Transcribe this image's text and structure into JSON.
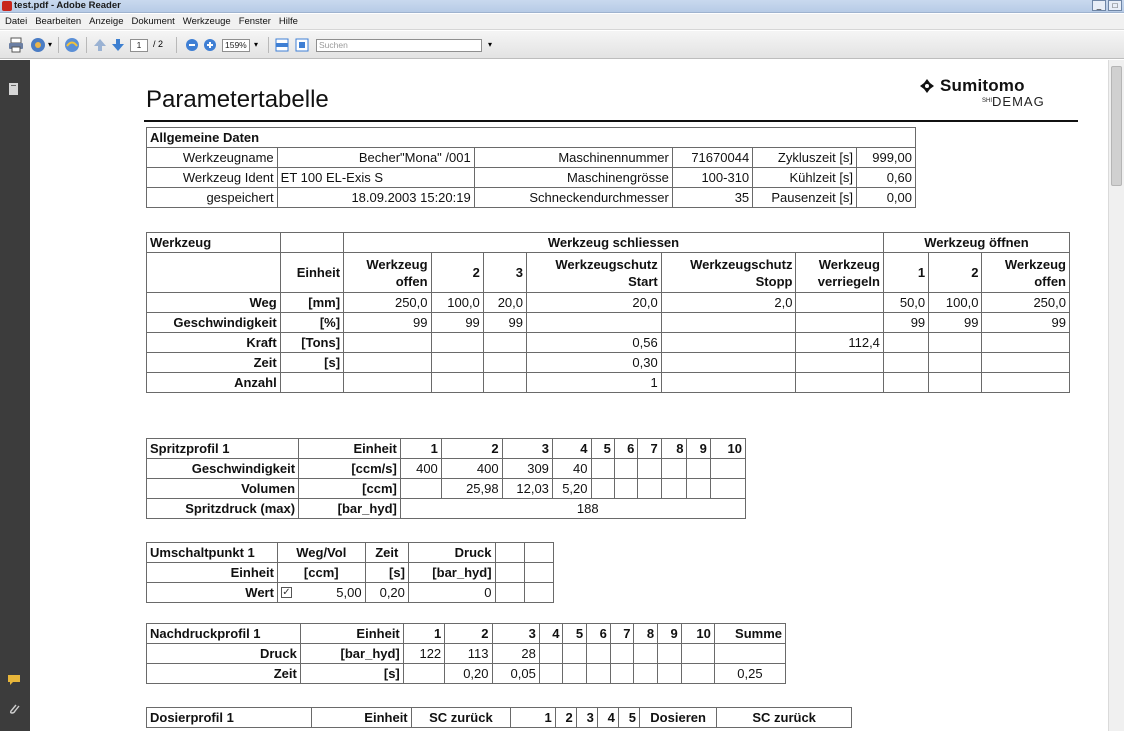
{
  "window": {
    "title": "test.pdf - Adobe Reader",
    "controls": [
      "_",
      "□",
      "×"
    ]
  },
  "menu": [
    "Datei",
    "Bearbeiten",
    "Anzeige",
    "Dokument",
    "Werkzeuge",
    "Fenster",
    "Hilfe"
  ],
  "toolbar": {
    "page_current": "1",
    "page_total": "/ 2",
    "zoom": "159%",
    "search_placeholder": "Suchen"
  },
  "page": {
    "title": "Parametertabelle",
    "logo_brand": "Sumitomo",
    "logo_sub": "DEMAG",
    "logo_prefix": "SHI"
  },
  "allgemein": {
    "header": "Allgemeine Daten",
    "rows": [
      [
        "Werkzeugname",
        "Becher\"Mona\"  /001",
        "Maschinennummer",
        "71670044",
        "Zykluszeit [s]",
        "999,00"
      ],
      [
        "Werkzeug Ident",
        "ET 100 EL-Exis S",
        "Maschinengrösse",
        "100-310",
        "Kühlzeit [s]",
        "0,60"
      ],
      [
        "gespeichert",
        "18.09.2003 15:20:19",
        "Schneckendurchmesser",
        "35",
        "Pausenzeit [s]",
        "0,00"
      ]
    ]
  },
  "werkzeug": {
    "title": "Werkzeug",
    "group_close": "Werkzeug schliessen",
    "group_open": "Werkzeug öffnen",
    "einheit": "Einheit",
    "cols": [
      "Werkzeug offen",
      "2",
      "3",
      "Werkzeugschutz Start",
      "Werkzeugschutz Stopp",
      "Werkzeug verriegeln",
      "1",
      "2",
      "Werkzeug offen"
    ],
    "rows": [
      {
        "label": "Weg",
        "unit": "[mm]",
        "v": [
          "250,0",
          "100,0",
          "20,0",
          "20,0",
          "2,0",
          "",
          "50,0",
          "100,0",
          "250,0"
        ]
      },
      {
        "label": "Geschwindigkeit",
        "unit": "[%]",
        "v": [
          "99",
          "99",
          "99",
          "",
          "",
          "",
          "99",
          "99",
          "99"
        ]
      },
      {
        "label": "Kraft",
        "unit": "[Tons]",
        "v": [
          "",
          "",
          "",
          "0,56",
          "",
          "112,4",
          "",
          "",
          ""
        ]
      },
      {
        "label": "Zeit",
        "unit": "[s]",
        "v": [
          "",
          "",
          "",
          "0,30",
          "",
          "",
          "",
          "",
          ""
        ]
      },
      {
        "label": "Anzahl",
        "unit": "",
        "v": [
          "",
          "",
          "",
          "1",
          "",
          "",
          "",
          "",
          ""
        ]
      }
    ]
  },
  "spritz": {
    "title": "Spritzprofil 1",
    "einheit": "Einheit",
    "cols": [
      "1",
      "2",
      "3",
      "4",
      "5",
      "6",
      "7",
      "8",
      "9",
      "10"
    ],
    "rows": [
      {
        "label": "Geschwindigkeit",
        "unit": "[ccm/s]",
        "v": [
          "400",
          "400",
          "309",
          "40",
          "",
          "",
          "",
          "",
          "",
          ""
        ]
      },
      {
        "label": "Volumen",
        "unit": "[ccm]",
        "v": [
          "",
          "25,98",
          "12,03",
          "5,20",
          "",
          "",
          "",
          "",
          "",
          ""
        ]
      }
    ],
    "druck_label": "Spritzdruck (max)",
    "druck_unit": "[bar_hyd]",
    "druck_value": "188"
  },
  "umschalt": {
    "title": "Umschaltpunkt 1",
    "cols": [
      "Weg/Vol",
      "Zeit",
      "Druck"
    ],
    "einheit_label": "Einheit",
    "units": [
      "[ccm]",
      "[s]",
      "[bar_hyd]"
    ],
    "wert_label": "Wert",
    "checkbox": "✓",
    "values": [
      "5,00",
      "0,20",
      "0"
    ]
  },
  "nachdruck": {
    "title": "Nachdruckprofil 1",
    "einheit": "Einheit",
    "cols": [
      "1",
      "2",
      "3",
      "4",
      "5",
      "6",
      "7",
      "8",
      "9",
      "10"
    ],
    "summe": "Summe",
    "rows": [
      {
        "label": "Druck",
        "unit": "[bar_hyd]",
        "v": [
          "122",
          "113",
          "28",
          "",
          "",
          "",
          "",
          "",
          "",
          ""
        ],
        "sum": ""
      },
      {
        "label": "Zeit",
        "unit": "[s]",
        "v": [
          "",
          "0,20",
          "0,05",
          "",
          "",
          "",
          "",
          "",
          "",
          ""
        ],
        "sum": "0,25"
      }
    ]
  },
  "dosier": {
    "title": "Dosierprofil 1",
    "einheit": "Einheit",
    "cols": [
      "SC zurück",
      "1",
      "2",
      "3",
      "4",
      "5",
      "Dosieren",
      "SC zurück"
    ]
  }
}
